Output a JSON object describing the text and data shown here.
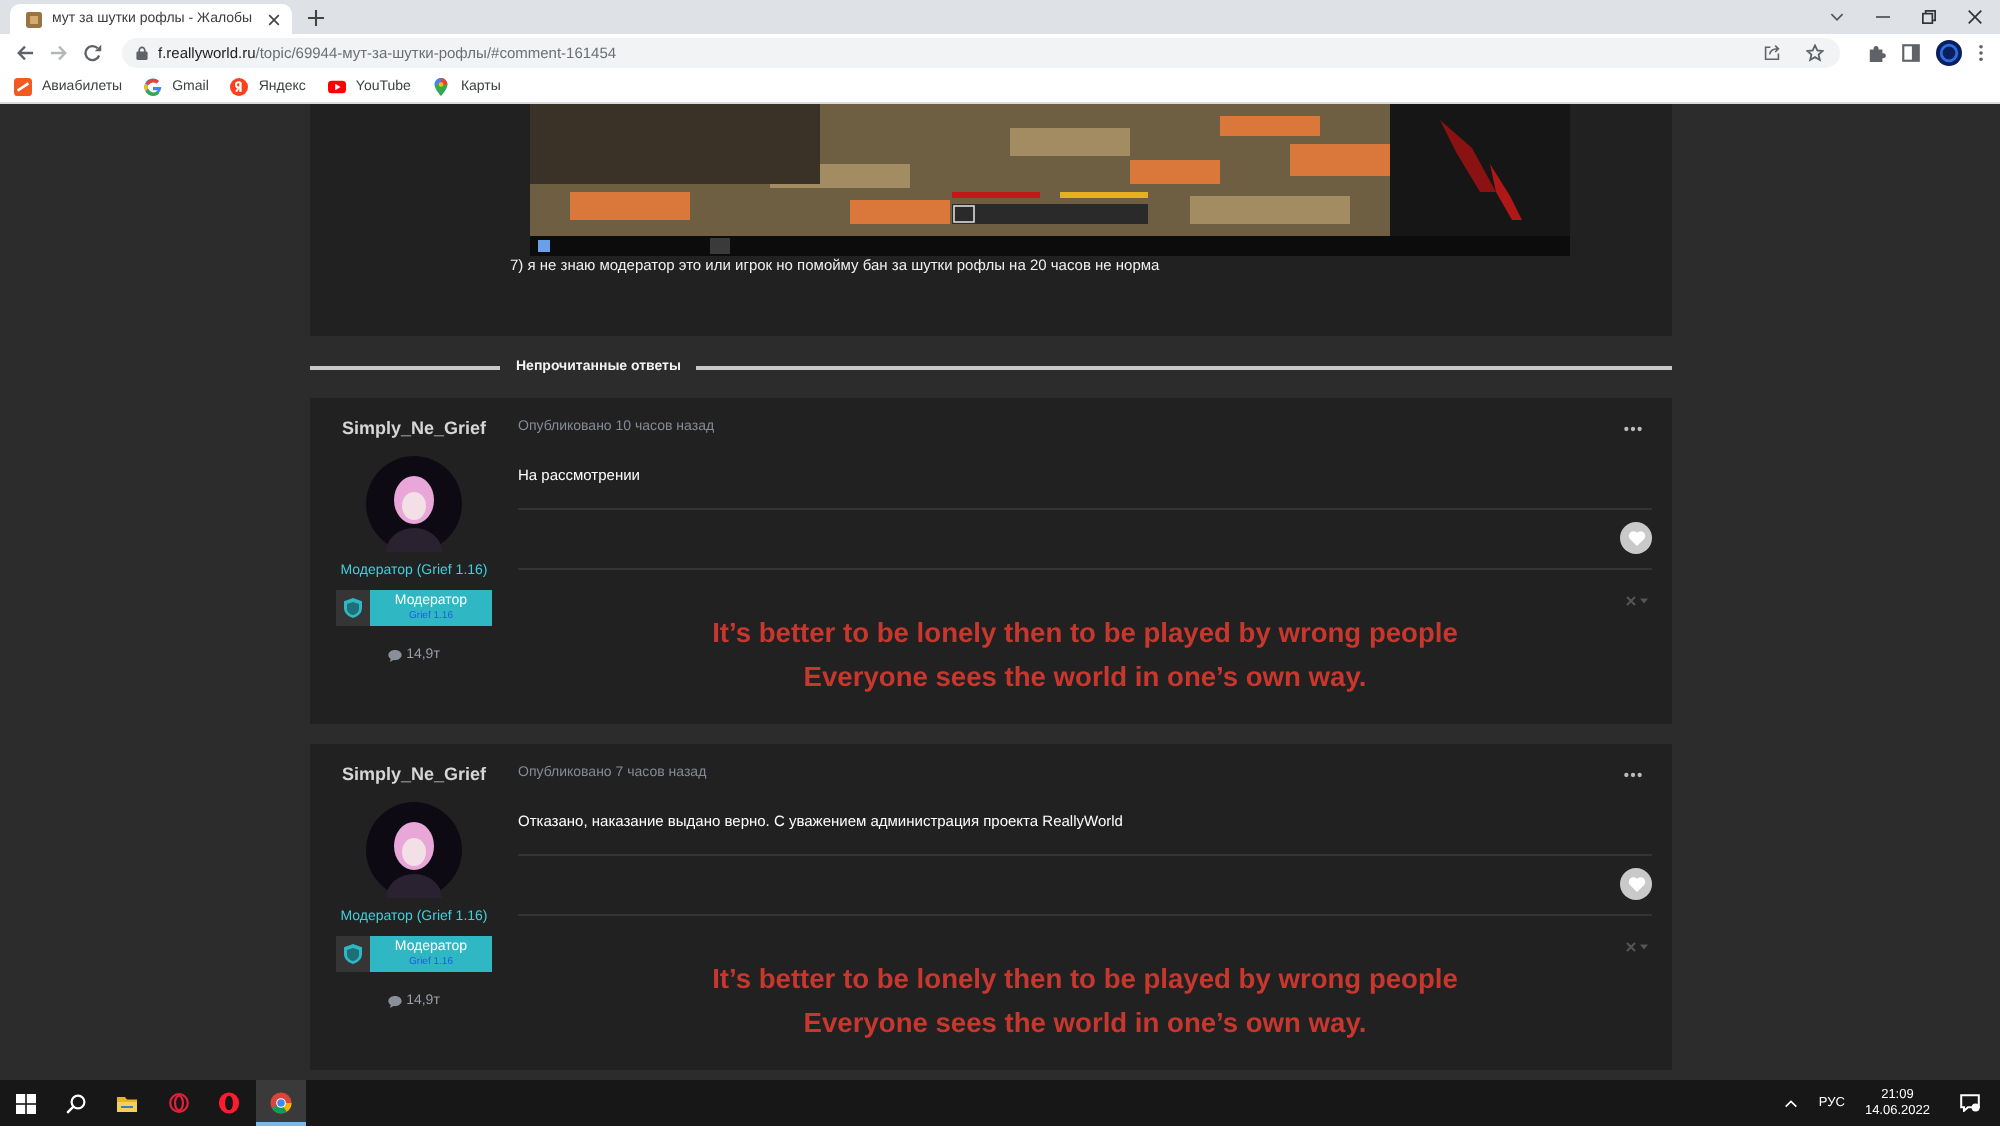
{
  "browser": {
    "tabs": [
      {
        "title": "мут за шутки рофлы - Жалобы",
        "selected": true
      }
    ],
    "address": {
      "domain": "f.reallyworld.ru",
      "path": "/topic/69944-мут-за-шутки-рофлы/#comment-161454"
    },
    "bookmarks": [
      {
        "kind": "flights",
        "label": "Авиабилеты"
      },
      {
        "kind": "google",
        "label": "Gmail"
      },
      {
        "kind": "yandex",
        "label": "Яндекс"
      },
      {
        "kind": "youtube",
        "label": "YouTube"
      },
      {
        "kind": "maps",
        "label": "Карты"
      }
    ]
  },
  "previous_post": {
    "text": "7) я не знаю модератор это или игрок но помойму бан за шутки рофлы на 20 часов не норма"
  },
  "unread_divider": {
    "label": "Непрочитанные ответы"
  },
  "posts": [
    {
      "author": "Simply_Ne_Grief",
      "role": "Модератор (Grief 1.16)",
      "badge": {
        "title": "Модератор",
        "subtitle": "Grief 1.16"
      },
      "post_count": "14,9т",
      "date": "Опубликовано 10 часов назад",
      "text": "На рассмотрении",
      "signature": [
        "It’s better to be lonely then to be played by wrong people",
        "Everyone sees the world in one’s own way."
      ]
    },
    {
      "author": "Simply_Ne_Grief",
      "role": "Модератор (Grief 1.16)",
      "badge": {
        "title": "Модератор",
        "subtitle": "Grief 1.16"
      },
      "post_count": "14,9т",
      "date": "Опубликовано 7 часов назад",
      "text": "Отказано, наказание выдано верно. С уважением администрация проекта ReallyWorld",
      "signature": [
        "It’s better to be lonely then to be played by wrong people",
        "Everyone sees the world in one’s own way."
      ]
    }
  ],
  "taskbar": {
    "apps": [
      {
        "kind": "start",
        "selected": false
      },
      {
        "kind": "search",
        "selected": false
      },
      {
        "kind": "explorer",
        "selected": false
      },
      {
        "kind": "opera-gx",
        "selected": false
      },
      {
        "kind": "opera",
        "selected": false
      },
      {
        "kind": "chrome",
        "selected": true
      }
    ],
    "language": "РУС",
    "time": "21:09",
    "date": "14.06.2022"
  }
}
